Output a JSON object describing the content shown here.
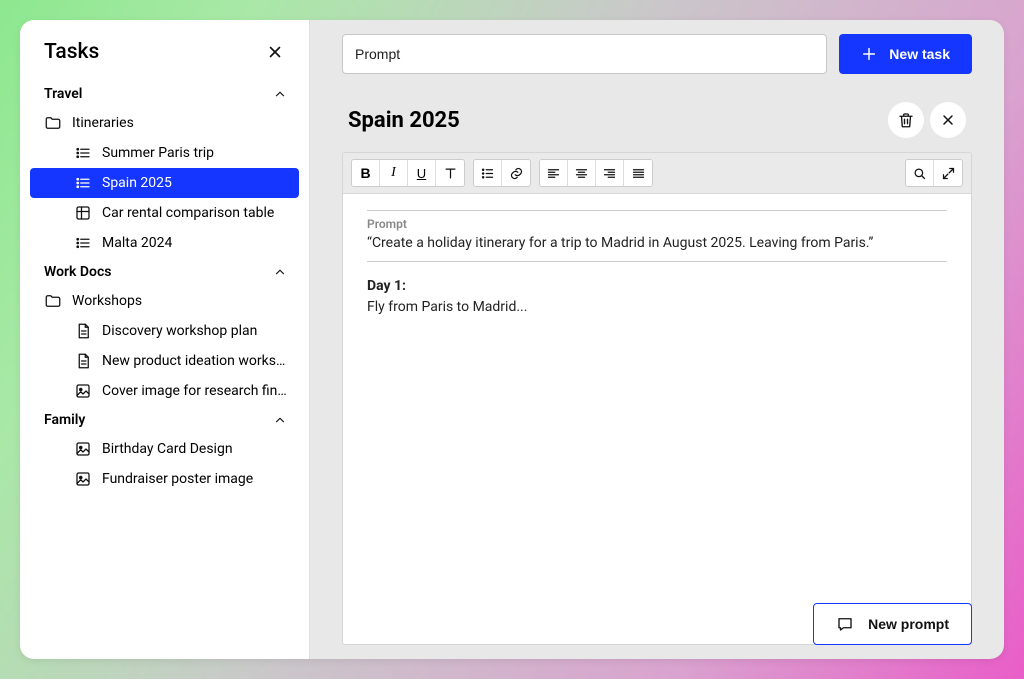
{
  "sidebar": {
    "title": "Tasks",
    "sections": [
      {
        "label": "Travel",
        "groups": [
          {
            "icon": "folder",
            "label": "Itineraries",
            "items": [
              {
                "icon": "list",
                "label": "Summer Paris trip",
                "active": false
              },
              {
                "icon": "list",
                "label": "Spain 2025",
                "active": true
              },
              {
                "icon": "table",
                "label": "Car rental comparison table",
                "active": false
              },
              {
                "icon": "list",
                "label": "Malta 2024",
                "active": false
              }
            ]
          }
        ]
      },
      {
        "label": "Work Docs",
        "groups": [
          {
            "icon": "folder",
            "label": "Workshops",
            "items": [
              {
                "icon": "doc",
                "label": "Discovery workshop plan",
                "active": false
              },
              {
                "icon": "doc",
                "label": "New product ideation worksh...",
                "active": false
              },
              {
                "icon": "image",
                "label": "Cover image for research findi...",
                "active": false
              }
            ]
          }
        ]
      },
      {
        "label": "Family",
        "groups": [
          {
            "icon": null,
            "label": null,
            "items": [
              {
                "icon": "image",
                "label": "Birthday Card Design",
                "active": false
              },
              {
                "icon": "image",
                "label": "Fundraiser poster image",
                "active": false
              }
            ]
          }
        ]
      }
    ]
  },
  "topbar": {
    "search_value": "Prompt",
    "new_task_label": "New task"
  },
  "document": {
    "title": "Spain 2025",
    "prompt_label": "Prompt",
    "prompt_text": "“Create a holiday itinerary for a trip to Madrid in August 2025. Leaving from Paris.”",
    "day_label": "Day 1:",
    "day_text": "Fly from Paris to Madrid...",
    "new_prompt_label": "New prompt"
  }
}
